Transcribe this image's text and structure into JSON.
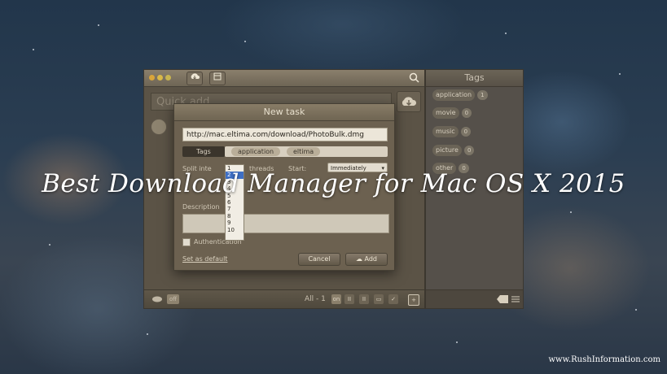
{
  "headline": "Best Download Manager for Mac OS X 2015",
  "site": "www.RushInformation.com",
  "window": {
    "quick_add_placeholder": "Quick add",
    "footer": {
      "all_count": "All - 1",
      "on_label": "on"
    }
  },
  "tags_panel": {
    "title": "Tags",
    "items": [
      {
        "name": "application",
        "count": "1"
      },
      {
        "name": "movie",
        "count": "0"
      },
      {
        "name": "music",
        "count": "0"
      },
      {
        "name": "picture",
        "count": "0"
      },
      {
        "name": "other",
        "count": "0"
      }
    ]
  },
  "dialog": {
    "title": "New task",
    "url": "http://mac.eltima.com/download/PhotoBulk.dmg",
    "tags_label": "Tags",
    "tags": [
      "application",
      "eltima"
    ],
    "split_label": "Split inte",
    "threads_label": "threads",
    "start_label": "Start:",
    "start_value": "Immediately",
    "thread_options": [
      "1",
      "2",
      "3",
      "4",
      "5",
      "6",
      "7",
      "8",
      "9",
      "10"
    ],
    "thread_selected": "2",
    "description_label": "Description",
    "auth_label": "Authentication",
    "set_default": "Set as default",
    "cancel": "Cancel",
    "add": "Add"
  }
}
